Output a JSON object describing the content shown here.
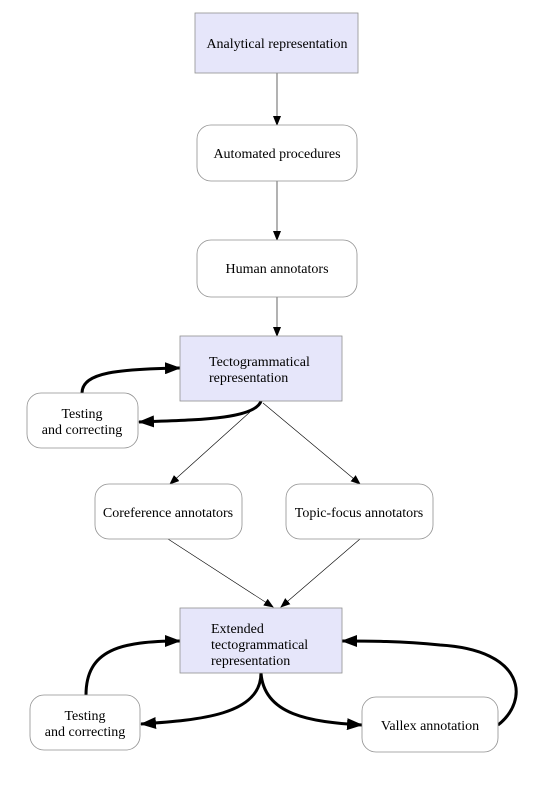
{
  "colors": {
    "highlight_fill": "#e6e6fa",
    "border": "#909090",
    "edge": "#000000"
  },
  "nodes": {
    "analytical": {
      "lines": [
        "Analytical representation"
      ],
      "highlighted": true
    },
    "automated": {
      "lines": [
        "Automated procedures"
      ],
      "highlighted": false
    },
    "human": {
      "lines": [
        "Human annotators"
      ],
      "highlighted": false
    },
    "tecto": {
      "lines": [
        "Tectogrammatical",
        "representation"
      ],
      "highlighted": true
    },
    "testing1": {
      "lines": [
        "Testing",
        "and correcting"
      ],
      "highlighted": false
    },
    "coref": {
      "lines": [
        "Coreference annotators"
      ],
      "highlighted": false
    },
    "topic": {
      "lines": [
        "Topic-focus annotators"
      ],
      "highlighted": false
    },
    "extended": {
      "lines": [
        "Extended",
        "tectogrammatical",
        "representation"
      ],
      "highlighted": true
    },
    "testing2": {
      "lines": [
        "Testing",
        "and correcting"
      ],
      "highlighted": false
    },
    "vallex": {
      "lines": [
        "Vallex annotation"
      ],
      "highlighted": false
    }
  }
}
